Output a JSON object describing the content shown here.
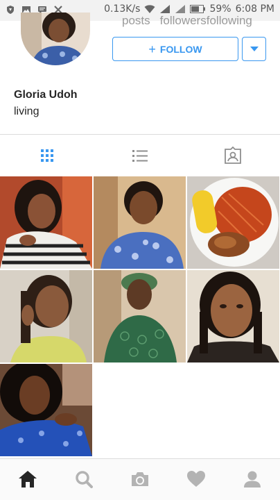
{
  "status_bar": {
    "speed": "0.13K/s",
    "battery": "59%",
    "time": "6:08 PM"
  },
  "profile": {
    "name": "Gloria Udoh",
    "bio": "living",
    "stats": {
      "posts_label": "posts",
      "followers_label": "followers",
      "following_label": "following"
    },
    "follow_label": "FOLLOW"
  },
  "tabs": [
    {
      "label": "grid-view-icon",
      "active": true
    },
    {
      "label": "list-view-icon",
      "active": false
    },
    {
      "label": "tagged-photos-icon",
      "active": false
    }
  ],
  "grid": {
    "photos": [
      {
        "subject": "woman in striped top"
      },
      {
        "subject": "woman in blue patterned dress"
      },
      {
        "subject": "plate of jollof rice with corn and chicken"
      },
      {
        "subject": "woman with braids in yellow top"
      },
      {
        "subject": "woman in green lace outfit"
      },
      {
        "subject": "woman with braids selfie"
      },
      {
        "subject": "woman in blue outfit selfie"
      }
    ]
  },
  "bottom_nav": [
    {
      "icon": "home-icon",
      "active": true
    },
    {
      "icon": "search-icon",
      "active": false
    },
    {
      "icon": "camera-icon",
      "active": false
    },
    {
      "icon": "heart-icon",
      "active": false
    },
    {
      "icon": "profile-icon",
      "active": false
    }
  ],
  "colors": {
    "accent": "#3897f0",
    "text": "#262626",
    "muted": "#9a9a9a",
    "border": "#dbdbdb"
  }
}
